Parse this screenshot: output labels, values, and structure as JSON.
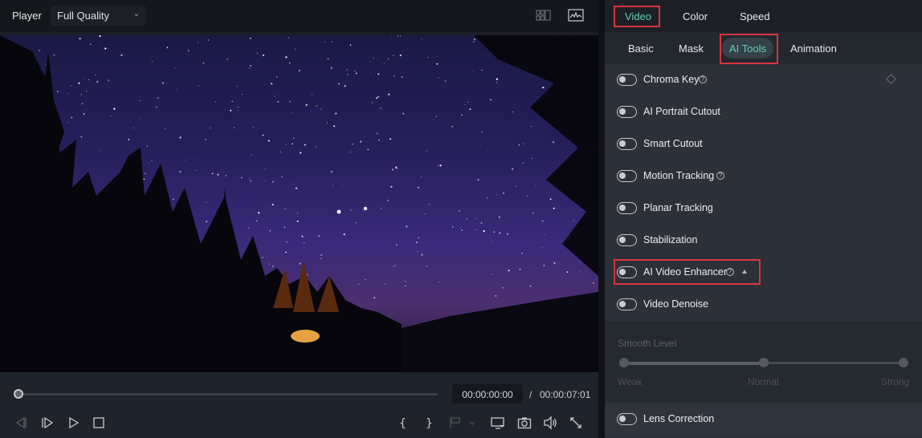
{
  "player": {
    "title": "Player",
    "quality": "Full Quality",
    "icons": [
      "grid-layout-icon",
      "waveform-image-icon"
    ]
  },
  "playback": {
    "progress": 0.0,
    "current_time": "00:00:00:00",
    "separator": "/",
    "total_time": "00:00:07:01",
    "buttons": [
      "previous-frame",
      "next-frame",
      "play",
      "stop",
      "mark-in",
      "mark-out",
      "marker",
      "display-settings",
      "snapshot",
      "volume",
      "fullscreen"
    ]
  },
  "panel": {
    "main_tabs": [
      {
        "label": "Video",
        "active": true
      },
      {
        "label": "Color",
        "active": false
      },
      {
        "label": "Speed",
        "active": false
      }
    ],
    "sub_tabs": [
      {
        "label": "Basic",
        "active": false
      },
      {
        "label": "Mask",
        "active": false
      },
      {
        "label": "AI Tools",
        "active": true
      },
      {
        "label": "Animation",
        "active": false
      }
    ],
    "features": [
      {
        "label": "Chroma Key",
        "enabled": false,
        "help": true
      },
      {
        "label": "AI Portrait Cutout",
        "enabled": false
      },
      {
        "label": "Smart Cutout",
        "enabled": false
      },
      {
        "label": "Motion Tracking",
        "enabled": false,
        "help": true
      },
      {
        "label": "Planar Tracking",
        "enabled": false
      },
      {
        "label": "Stabilization",
        "enabled": false
      },
      {
        "label": "AI Video Enhancer",
        "enabled": false,
        "help": true,
        "expanded": true
      },
      {
        "label": "Video Denoise",
        "enabled": false
      }
    ],
    "smooth": {
      "label": "Smooth Level",
      "levels": [
        "Weak",
        "Normal",
        "Strong"
      ],
      "selected": "Normal",
      "disabled": true
    },
    "lens_correction": {
      "label": "Lens Correction",
      "enabled": false
    }
  },
  "colors": {
    "accent": "#5fd3bd",
    "highlight_box": "#d9343f",
    "panel_bg": "#2c3038"
  }
}
